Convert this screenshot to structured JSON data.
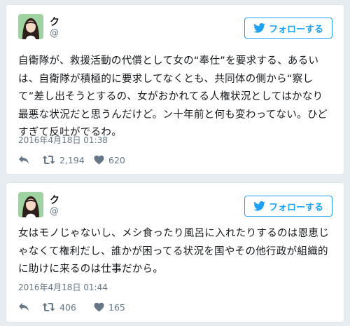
{
  "tweets": [
    {
      "author": {
        "name": "ク",
        "handle": "@"
      },
      "follow_label": "フォローする",
      "text": "自衛隊が、救援活動の代償として女の“奉仕”を要求する、あるいは、自衛隊が積極的に要求してなくとも、共同体の側から“察して”差し出そうとするの、女がおかれてる人権状況としてはかなり最悪な状況だと思うんだけど。ン十年前と何も変わってない。ひどすぎて反吐がでるわ。",
      "timestamp": "2016年4月18日 01:38",
      "retweets": "2,194",
      "likes": "620"
    },
    {
      "author": {
        "name": "ク",
        "handle": "@"
      },
      "follow_label": "フォローする",
      "text": "女はモノじゃないし、メシ食ったり風呂に入れたりするのは恩恵じゃなくて権利だし、誰かが困ってる状況を国やその他行政が組織的に助けに来るのは仕事だから。",
      "timestamp": "2016年4月18日 01:44",
      "retweets": "406",
      "likes": "165"
    }
  ],
  "colors": {
    "accent": "#1da1f2",
    "muted": "#657786",
    "background": "#e6ecf0"
  },
  "icons": [
    "bird-icon",
    "reply-icon",
    "retweet-icon",
    "heart-icon"
  ]
}
